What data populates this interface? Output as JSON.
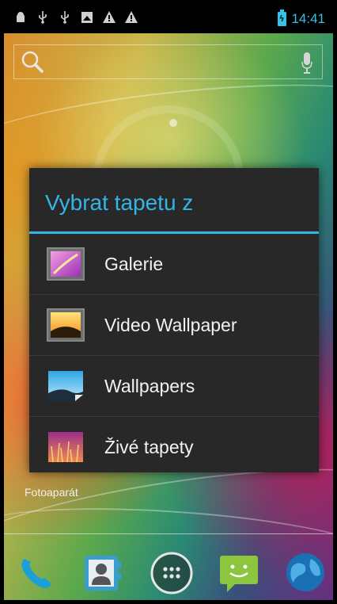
{
  "status_bar": {
    "left_icons": [
      "android-debug-icon",
      "usb-icon",
      "usb-icon",
      "image-notification-icon",
      "warning-icon",
      "warning-icon"
    ],
    "time": "14:41",
    "battery": "charging"
  },
  "search": {
    "placeholder": ""
  },
  "dialog": {
    "title": "Vybrat tapetu z",
    "items": [
      {
        "label": "Galerie",
        "icon": "gallery-icon"
      },
      {
        "label": "Video Wallpaper",
        "icon": "video-wallpaper-icon"
      },
      {
        "label": "Wallpapers",
        "icon": "wallpapers-icon"
      },
      {
        "label": "Živé tapety",
        "icon": "live-wallpaper-icon"
      }
    ]
  },
  "home": {
    "shortcut_label": "Fotoaparát",
    "dock": [
      "phone-icon",
      "contacts-icon",
      "app-drawer-icon",
      "messaging-icon",
      "browser-icon"
    ]
  },
  "colors": {
    "accent": "#35b5e5",
    "dialog_bg": "#282828"
  }
}
